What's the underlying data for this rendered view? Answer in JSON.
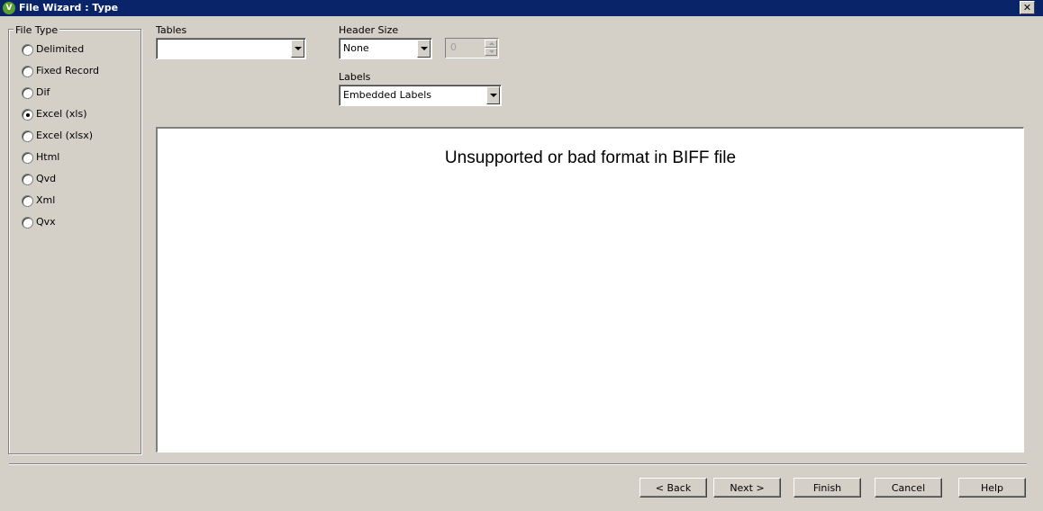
{
  "window": {
    "title": "File Wizard : Type",
    "app_icon_letter": "V",
    "close_glyph": "✕"
  },
  "file_type": {
    "legend": "File Type",
    "options": [
      {
        "label": "Delimited",
        "checked": false
      },
      {
        "label": "Fixed Record",
        "checked": false
      },
      {
        "label": "Dif",
        "checked": false
      },
      {
        "label": "Excel (xls)",
        "checked": true
      },
      {
        "label": "Excel (xlsx)",
        "checked": false
      },
      {
        "label": "Html",
        "checked": false
      },
      {
        "label": "Qvd",
        "checked": false
      },
      {
        "label": "Xml",
        "checked": false
      },
      {
        "label": "Qvx",
        "checked": false
      }
    ]
  },
  "tables": {
    "label": "Tables",
    "value": ""
  },
  "header_size": {
    "label": "Header Size",
    "value": "None",
    "spinner_value": "0"
  },
  "labels": {
    "label": "Labels",
    "value": "Embedded Labels"
  },
  "preview": {
    "message": "Unsupported or bad format in BIFF file"
  },
  "buttons": {
    "back": "< Back",
    "next": "Next >",
    "finish": "Finish",
    "cancel": "Cancel",
    "help": "Help"
  }
}
